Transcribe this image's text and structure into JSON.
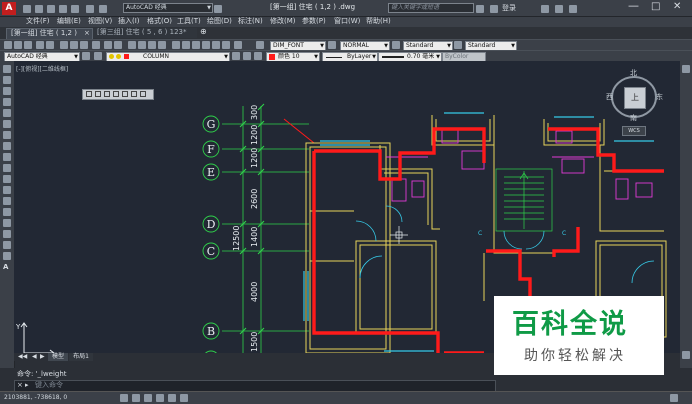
{
  "titlebar": {
    "workspace": "AutoCAD 经典",
    "doc_title": "[第一组] 住宅 ( 1,2 ) .dwg",
    "search_placeholder": "键入关键字或短语",
    "login": "登录"
  },
  "menu": {
    "items": [
      "文件(F)",
      "编辑(E)",
      "视图(V)",
      "插入(I)",
      "格式(O)",
      "工具(T)",
      "绘图(D)",
      "标注(N)",
      "修改(M)",
      "参数(P)",
      "窗口(W)",
      "帮助(H)"
    ]
  },
  "tabs": [
    {
      "label": "[第一组] 住宅 ( 1,2 )"
    },
    {
      "label": "[第三组] 住宅 ( 5 , 6 ) 123*"
    }
  ],
  "toolbar1": {
    "dim_style": "DIM_FONT",
    "text_style": "NORMAL",
    "table_style": "Standard",
    "mleader_style": "Standard"
  },
  "toolbar2": {
    "workspace": "AutoCAD 经典",
    "layer": "COLUMN",
    "color": "颜色 10",
    "linetype": "ByLayer",
    "lineweight": "0.70 毫米",
    "plotstyle": "ByColor"
  },
  "viewport_label": "[-][俯视][二维线框]",
  "viewcube": {
    "north": "北",
    "south": "南",
    "east": "东",
    "west": "西",
    "top": "上",
    "wcs": "WCS"
  },
  "axes": {
    "rows": [
      "G",
      "F",
      "E",
      "D",
      "C",
      "B"
    ],
    "dims_small": [
      "300",
      "1200",
      "1200",
      "2600",
      "1400",
      "4000",
      "1500"
    ],
    "dims_total": "12500"
  },
  "layout_tabs": [
    "模型",
    "布局1"
  ],
  "command": {
    "history": "命令: '_lweight",
    "prompt": "键入命令"
  },
  "status": {
    "coords": "2103881, -738618, 0"
  },
  "watermark": {
    "main": "百科全说",
    "sub": "助你轻松解决"
  },
  "colors": {
    "wall_red": "#ff1a1a",
    "axis_green": "#2fd24a",
    "wall_yellow": "#e8d35a",
    "fixture_magenta": "#e23ad6",
    "window_cyan": "#36c9e6",
    "watermark_green": "#0f9a46"
  }
}
